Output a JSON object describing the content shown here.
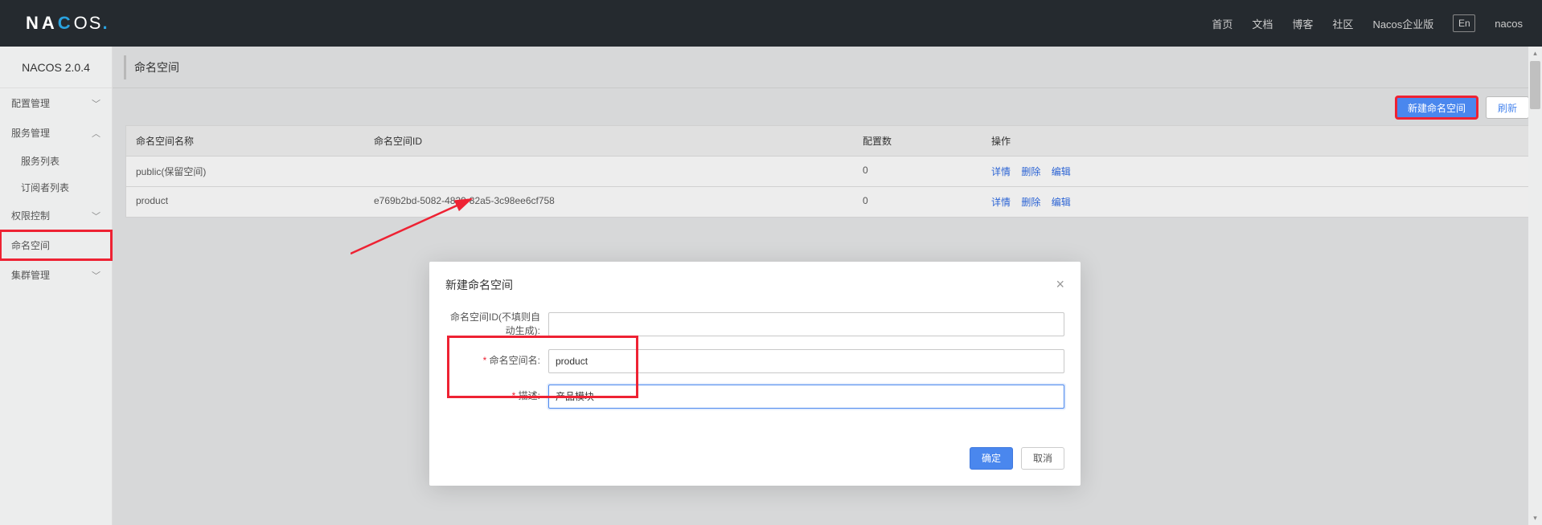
{
  "header": {
    "logo_na": "N",
    "logo_a": "A",
    "logo_c": "C",
    "logo_o": "O",
    "logo_s": "S",
    "logo_dot": ".",
    "nav": {
      "home": "首页",
      "docs": "文档",
      "blog": "博客",
      "community": "社区",
      "enterprise": "Nacos企业版",
      "lang": "En",
      "user": "nacos"
    }
  },
  "sidebar": {
    "version": "NACOS 2.0.4",
    "items": {
      "config_mgmt": "配置管理",
      "service_mgmt": "服务管理",
      "service_list": "服务列表",
      "subscriber_list": "订阅者列表",
      "access_control": "权限控制",
      "namespace": "命名空间",
      "cluster_mgmt": "集群管理"
    }
  },
  "page": {
    "title": "命名空间",
    "toolbar": {
      "create": "新建命名空间",
      "refresh": "刷新"
    },
    "table": {
      "cols": {
        "name": "命名空间名称",
        "id": "命名空间ID",
        "cfg": "配置数",
        "op": "操作"
      },
      "ops": {
        "detail": "详情",
        "delete": "删除",
        "edit": "编辑"
      },
      "rows": [
        {
          "name": "public(保留空间)",
          "id": "",
          "cfg": "0"
        },
        {
          "name": "product",
          "id": "e769b2bd-5082-4829-82a5-3c98ee6cf758",
          "cfg": "0"
        }
      ]
    }
  },
  "modal": {
    "title": "新建命名空间",
    "labels": {
      "id": "命名空间ID(不填则自动生成):",
      "name": "命名空间名:",
      "desc": "描述:"
    },
    "values": {
      "id": "",
      "name": "product",
      "desc": "产品模块"
    },
    "buttons": {
      "ok": "确定",
      "cancel": "取消"
    }
  }
}
